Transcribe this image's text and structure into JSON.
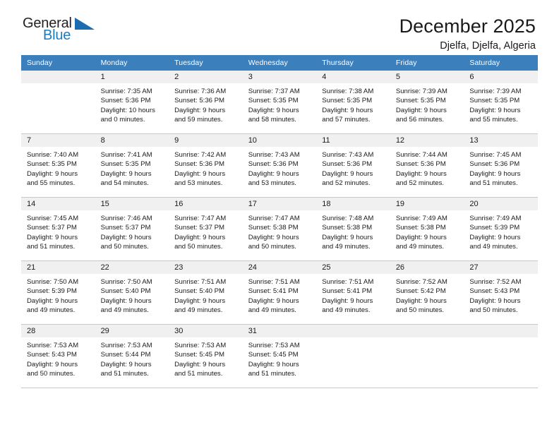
{
  "brand": {
    "name_top": "General",
    "name_bottom": "Blue",
    "triangle_color": "#1b6cb0",
    "blue_color": "#1b7bc0"
  },
  "header": {
    "title": "December 2025",
    "subtitle": "Djelfa, Djelfa, Algeria"
  },
  "theme": {
    "header_row_bg": "#3c7fbd",
    "daynum_bg": "#f0f0f0",
    "grid_line": "#c8c8c8",
    "text": "#1a1a1a"
  },
  "calendar": {
    "weekday_headers": [
      "Sunday",
      "Monday",
      "Tuesday",
      "Wednesday",
      "Thursday",
      "Friday",
      "Saturday"
    ],
    "weeks": [
      [
        {
          "day": "",
          "empty": true,
          "sunrise": "",
          "sunset": "",
          "daylight_1": "",
          "daylight_2": ""
        },
        {
          "day": "1",
          "sunrise": "Sunrise: 7:35 AM",
          "sunset": "Sunset: 5:36 PM",
          "daylight_1": "Daylight: 10 hours",
          "daylight_2": "and 0 minutes."
        },
        {
          "day": "2",
          "sunrise": "Sunrise: 7:36 AM",
          "sunset": "Sunset: 5:36 PM",
          "daylight_1": "Daylight: 9 hours",
          "daylight_2": "and 59 minutes."
        },
        {
          "day": "3",
          "sunrise": "Sunrise: 7:37 AM",
          "sunset": "Sunset: 5:35 PM",
          "daylight_1": "Daylight: 9 hours",
          "daylight_2": "and 58 minutes."
        },
        {
          "day": "4",
          "sunrise": "Sunrise: 7:38 AM",
          "sunset": "Sunset: 5:35 PM",
          "daylight_1": "Daylight: 9 hours",
          "daylight_2": "and 57 minutes."
        },
        {
          "day": "5",
          "sunrise": "Sunrise: 7:39 AM",
          "sunset": "Sunset: 5:35 PM",
          "daylight_1": "Daylight: 9 hours",
          "daylight_2": "and 56 minutes."
        },
        {
          "day": "6",
          "sunrise": "Sunrise: 7:39 AM",
          "sunset": "Sunset: 5:35 PM",
          "daylight_1": "Daylight: 9 hours",
          "daylight_2": "and 55 minutes."
        }
      ],
      [
        {
          "day": "7",
          "sunrise": "Sunrise: 7:40 AM",
          "sunset": "Sunset: 5:35 PM",
          "daylight_1": "Daylight: 9 hours",
          "daylight_2": "and 55 minutes."
        },
        {
          "day": "8",
          "sunrise": "Sunrise: 7:41 AM",
          "sunset": "Sunset: 5:35 PM",
          "daylight_1": "Daylight: 9 hours",
          "daylight_2": "and 54 minutes."
        },
        {
          "day": "9",
          "sunrise": "Sunrise: 7:42 AM",
          "sunset": "Sunset: 5:36 PM",
          "daylight_1": "Daylight: 9 hours",
          "daylight_2": "and 53 minutes."
        },
        {
          "day": "10",
          "sunrise": "Sunrise: 7:43 AM",
          "sunset": "Sunset: 5:36 PM",
          "daylight_1": "Daylight: 9 hours",
          "daylight_2": "and 53 minutes."
        },
        {
          "day": "11",
          "sunrise": "Sunrise: 7:43 AM",
          "sunset": "Sunset: 5:36 PM",
          "daylight_1": "Daylight: 9 hours",
          "daylight_2": "and 52 minutes."
        },
        {
          "day": "12",
          "sunrise": "Sunrise: 7:44 AM",
          "sunset": "Sunset: 5:36 PM",
          "daylight_1": "Daylight: 9 hours",
          "daylight_2": "and 52 minutes."
        },
        {
          "day": "13",
          "sunrise": "Sunrise: 7:45 AM",
          "sunset": "Sunset: 5:36 PM",
          "daylight_1": "Daylight: 9 hours",
          "daylight_2": "and 51 minutes."
        }
      ],
      [
        {
          "day": "14",
          "sunrise": "Sunrise: 7:45 AM",
          "sunset": "Sunset: 5:37 PM",
          "daylight_1": "Daylight: 9 hours",
          "daylight_2": "and 51 minutes."
        },
        {
          "day": "15",
          "sunrise": "Sunrise: 7:46 AM",
          "sunset": "Sunset: 5:37 PM",
          "daylight_1": "Daylight: 9 hours",
          "daylight_2": "and 50 minutes."
        },
        {
          "day": "16",
          "sunrise": "Sunrise: 7:47 AM",
          "sunset": "Sunset: 5:37 PM",
          "daylight_1": "Daylight: 9 hours",
          "daylight_2": "and 50 minutes."
        },
        {
          "day": "17",
          "sunrise": "Sunrise: 7:47 AM",
          "sunset": "Sunset: 5:38 PM",
          "daylight_1": "Daylight: 9 hours",
          "daylight_2": "and 50 minutes."
        },
        {
          "day": "18",
          "sunrise": "Sunrise: 7:48 AM",
          "sunset": "Sunset: 5:38 PM",
          "daylight_1": "Daylight: 9 hours",
          "daylight_2": "and 49 minutes."
        },
        {
          "day": "19",
          "sunrise": "Sunrise: 7:49 AM",
          "sunset": "Sunset: 5:38 PM",
          "daylight_1": "Daylight: 9 hours",
          "daylight_2": "and 49 minutes."
        },
        {
          "day": "20",
          "sunrise": "Sunrise: 7:49 AM",
          "sunset": "Sunset: 5:39 PM",
          "daylight_1": "Daylight: 9 hours",
          "daylight_2": "and 49 minutes."
        }
      ],
      [
        {
          "day": "21",
          "sunrise": "Sunrise: 7:50 AM",
          "sunset": "Sunset: 5:39 PM",
          "daylight_1": "Daylight: 9 hours",
          "daylight_2": "and 49 minutes."
        },
        {
          "day": "22",
          "sunrise": "Sunrise: 7:50 AM",
          "sunset": "Sunset: 5:40 PM",
          "daylight_1": "Daylight: 9 hours",
          "daylight_2": "and 49 minutes."
        },
        {
          "day": "23",
          "sunrise": "Sunrise: 7:51 AM",
          "sunset": "Sunset: 5:40 PM",
          "daylight_1": "Daylight: 9 hours",
          "daylight_2": "and 49 minutes."
        },
        {
          "day": "24",
          "sunrise": "Sunrise: 7:51 AM",
          "sunset": "Sunset: 5:41 PM",
          "daylight_1": "Daylight: 9 hours",
          "daylight_2": "and 49 minutes."
        },
        {
          "day": "25",
          "sunrise": "Sunrise: 7:51 AM",
          "sunset": "Sunset: 5:41 PM",
          "daylight_1": "Daylight: 9 hours",
          "daylight_2": "and 49 minutes."
        },
        {
          "day": "26",
          "sunrise": "Sunrise: 7:52 AM",
          "sunset": "Sunset: 5:42 PM",
          "daylight_1": "Daylight: 9 hours",
          "daylight_2": "and 50 minutes."
        },
        {
          "day": "27",
          "sunrise": "Sunrise: 7:52 AM",
          "sunset": "Sunset: 5:43 PM",
          "daylight_1": "Daylight: 9 hours",
          "daylight_2": "and 50 minutes."
        }
      ],
      [
        {
          "day": "28",
          "sunrise": "Sunrise: 7:53 AM",
          "sunset": "Sunset: 5:43 PM",
          "daylight_1": "Daylight: 9 hours",
          "daylight_2": "and 50 minutes."
        },
        {
          "day": "29",
          "sunrise": "Sunrise: 7:53 AM",
          "sunset": "Sunset: 5:44 PM",
          "daylight_1": "Daylight: 9 hours",
          "daylight_2": "and 51 minutes."
        },
        {
          "day": "30",
          "sunrise": "Sunrise: 7:53 AM",
          "sunset": "Sunset: 5:45 PM",
          "daylight_1": "Daylight: 9 hours",
          "daylight_2": "and 51 minutes."
        },
        {
          "day": "31",
          "sunrise": "Sunrise: 7:53 AM",
          "sunset": "Sunset: 5:45 PM",
          "daylight_1": "Daylight: 9 hours",
          "daylight_2": "and 51 minutes."
        },
        {
          "day": "",
          "empty": true,
          "sunrise": "",
          "sunset": "",
          "daylight_1": "",
          "daylight_2": ""
        },
        {
          "day": "",
          "empty": true,
          "sunrise": "",
          "sunset": "",
          "daylight_1": "",
          "daylight_2": ""
        },
        {
          "day": "",
          "empty": true,
          "sunrise": "",
          "sunset": "",
          "daylight_1": "",
          "daylight_2": ""
        }
      ]
    ]
  }
}
